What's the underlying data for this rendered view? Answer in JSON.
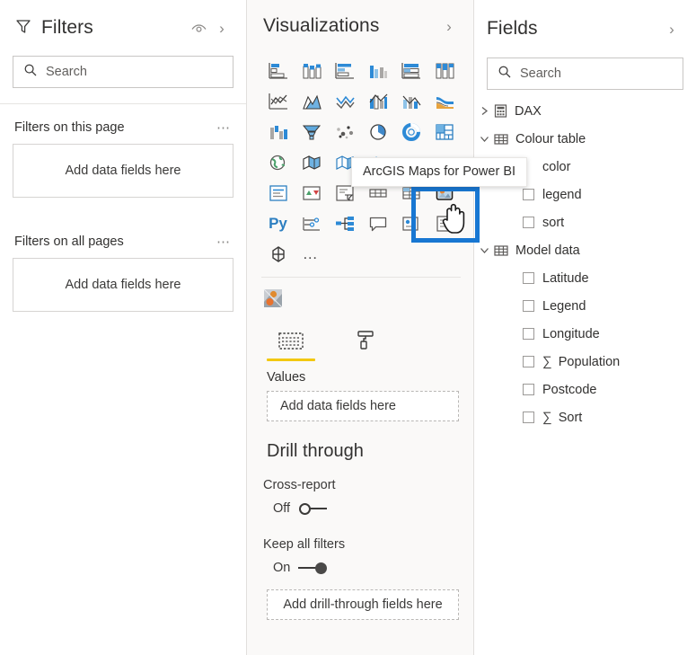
{
  "filters": {
    "title": "Filters",
    "eye_icon": "eye-icon",
    "collapse_icon": "chevron-right-icon",
    "funnel_icon": "funnel-icon",
    "search": {
      "placeholder": "Search",
      "icon": "search-icon"
    },
    "groups": [
      {
        "label": "Filters on this page",
        "menu": "⋯",
        "dropzone": "Add data fields here"
      },
      {
        "label": "Filters on all pages",
        "menu": "⋯",
        "dropzone": "Add data fields here"
      }
    ]
  },
  "visualizations": {
    "title": "Visualizations",
    "collapse_icon": "chevron-right-icon",
    "icons": [
      {
        "name": "stacked-bar-chart-icon"
      },
      {
        "name": "stacked-column-chart-icon"
      },
      {
        "name": "clustered-bar-chart-icon"
      },
      {
        "name": "clustered-column-chart-icon"
      },
      {
        "name": "100-stacked-bar-chart-icon"
      },
      {
        "name": "100-stacked-column-chart-icon"
      },
      {
        "name": "line-chart-icon"
      },
      {
        "name": "area-chart-icon"
      },
      {
        "name": "stacked-area-chart-icon"
      },
      {
        "name": "line-stacked-column-chart-icon"
      },
      {
        "name": "line-clustered-column-chart-icon"
      },
      {
        "name": "ribbon-chart-icon"
      },
      {
        "name": "waterfall-chart-icon"
      },
      {
        "name": "funnel-chart-icon"
      },
      {
        "name": "scatter-chart-icon"
      },
      {
        "name": "pie-chart-icon"
      },
      {
        "name": "donut-chart-icon"
      },
      {
        "name": "treemap-icon"
      },
      {
        "name": "map-icon"
      },
      {
        "name": "filled-map-icon"
      },
      {
        "name": "shape-map-icon"
      },
      {
        "name": "azure-map-icon"
      },
      {
        "name": "gauge-icon"
      },
      {
        "name": "card-icon"
      },
      {
        "name": "multi-row-card-icon"
      },
      {
        "name": "kpi-icon"
      },
      {
        "name": "slicer-icon"
      },
      {
        "name": "table-icon"
      },
      {
        "name": "matrix-icon"
      },
      {
        "name": "arcgis-maps-icon"
      },
      {
        "name": "python-visual-icon",
        "text": "Py"
      },
      {
        "name": "key-influencers-icon"
      },
      {
        "name": "decomposition-tree-icon"
      },
      {
        "name": "q-and-a-icon"
      },
      {
        "name": "smart-narrative-icon"
      },
      {
        "name": "paginated-report-icon"
      },
      {
        "name": "power-apps-icon"
      },
      {
        "name": "more-visuals-icon",
        "text": "…"
      }
    ],
    "custom_visual": {
      "name": "imported-custom-visual-icon"
    },
    "tooltip": "ArcGIS Maps for Power BI",
    "highlight_color": "#1877d2",
    "selected_icon": "arcgis-maps-icon",
    "tabs": [
      {
        "label_icon": "fields-pane-icon",
        "active": true
      },
      {
        "label_icon": "format-paintroller-icon",
        "active": false
      }
    ],
    "values": {
      "label": "Values",
      "dropzone": "Add data fields here"
    },
    "drill_through": {
      "title": "Drill through",
      "cross_report": {
        "label": "Cross-report",
        "state": "Off",
        "on": false
      },
      "keep_all_filters": {
        "label": "Keep all filters",
        "state": "On",
        "on": true
      },
      "dropzone": "Add drill-through fields here"
    }
  },
  "fields": {
    "title": "Fields",
    "collapse_icon": "chevron-right-icon",
    "search": {
      "placeholder": "Search",
      "icon": "search-icon"
    },
    "tree": [
      {
        "label": "DAX",
        "expanded": false,
        "icon": "dax-table-icon",
        "children": []
      },
      {
        "label": "Colour table",
        "expanded": true,
        "icon": "table-icon",
        "children": [
          {
            "label": "color",
            "aggregate": false
          },
          {
            "label": "legend",
            "aggregate": false
          },
          {
            "label": "sort",
            "aggregate": false
          }
        ]
      },
      {
        "label": "Model data",
        "expanded": true,
        "icon": "table-icon",
        "children": [
          {
            "label": "Latitude",
            "aggregate": false
          },
          {
            "label": "Legend",
            "aggregate": false
          },
          {
            "label": "Longitude",
            "aggregate": false
          },
          {
            "label": "Population",
            "aggregate": true
          },
          {
            "label": "Postcode",
            "aggregate": false
          },
          {
            "label": "Sort",
            "aggregate": true
          }
        ]
      }
    ],
    "sigma": "∑"
  }
}
